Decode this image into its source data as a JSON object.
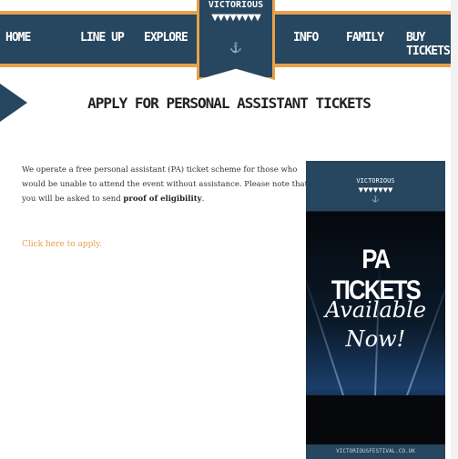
{
  "nav": {
    "items": [
      "HOME",
      "LINE UP",
      "EXPLORE",
      "INFO",
      "FAMILY",
      "BUY TICKETS"
    ],
    "logo": {
      "name": "VICTORIOUS",
      "flags": "▼▼▼▼▼▼▼▼",
      "anchor": "⚓"
    }
  },
  "page": {
    "title": "APPLY FOR PERSONAL ASSISTANT TICKETS",
    "paragraph": "We operate a free personal assistant (PA) ticket scheme for those who would be unable to attend the event without assistance. Please note that you will be asked to send ",
    "paragraph_bold": "proof of eligibility",
    "paragraph_end": ".",
    "apply_link": "Click here to apply."
  },
  "poster": {
    "logo": "VICTORIOUS",
    "flags": "▼▼▼▼▼▼▼",
    "anchor": "⚓",
    "headline": "PA TICKETS",
    "sub1": "Available",
    "sub2": "Now!",
    "footer": "VICTORIOUSFESTIVAL.CO.UK"
  },
  "colors": {
    "navy": "#27465f",
    "accent": "#e8a14b"
  }
}
